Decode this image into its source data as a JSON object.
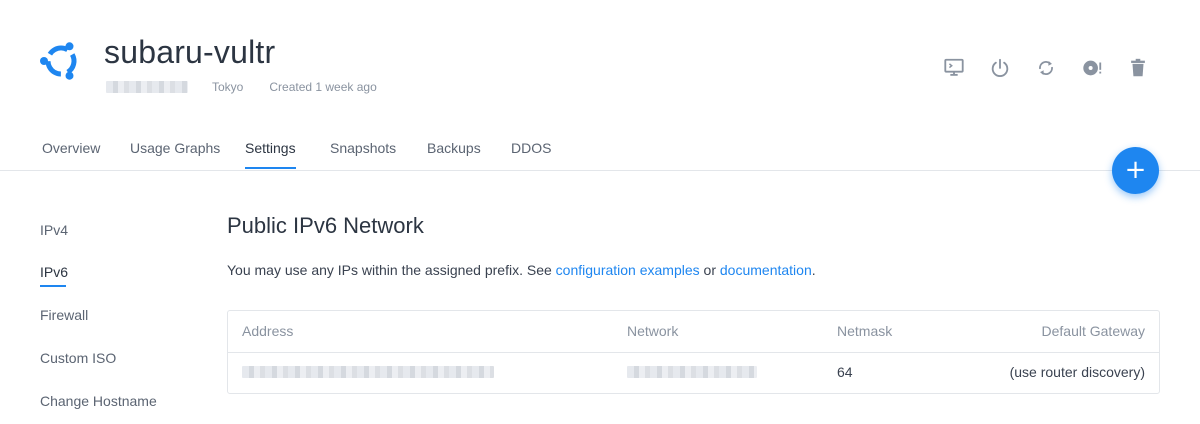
{
  "header": {
    "title": "subaru-vultr",
    "location": "Tokyo",
    "created": "Created 1 week ago",
    "accent": "#1e86f0"
  },
  "actions": [
    {
      "name": "console-icon"
    },
    {
      "name": "power-icon"
    },
    {
      "name": "restart-icon"
    },
    {
      "name": "iso-icon"
    },
    {
      "name": "trash-icon"
    }
  ],
  "tabs": {
    "overview": "Overview",
    "usage_graphs": "Usage Graphs",
    "settings": "Settings",
    "snapshots": "Snapshots",
    "backups": "Backups",
    "ddos": "DDOS",
    "active": "Settings"
  },
  "fab": {
    "label": "+"
  },
  "sidenav": {
    "ipv4": "IPv4",
    "ipv6": "IPv6",
    "firewall": "Firewall",
    "custom_iso": "Custom ISO",
    "change_hostname": "Change Hostname",
    "active": "IPv6"
  },
  "main": {
    "title": "Public IPv6 Network",
    "desc_prefix": "You may use any IPs within the assigned prefix. See ",
    "link_config": "configuration examples",
    "desc_or": " or ",
    "link_docs": "documentation",
    "desc_suffix": "."
  },
  "table": {
    "headers": {
      "address": "Address",
      "network": "Network",
      "netmask": "Netmask",
      "gateway": "Default Gateway"
    },
    "rows": [
      {
        "netmask": "64",
        "gateway": "(use router discovery)"
      }
    ]
  }
}
